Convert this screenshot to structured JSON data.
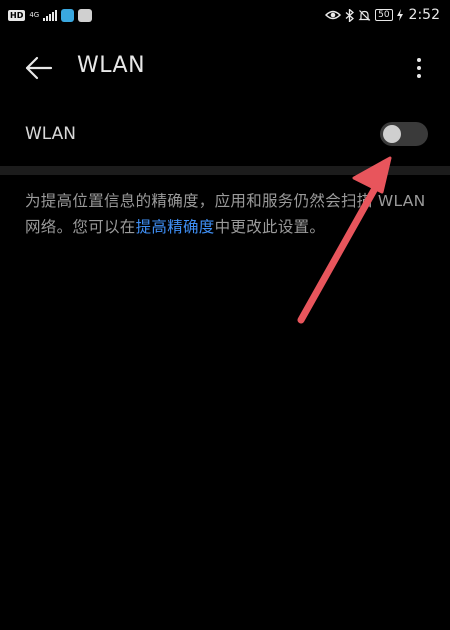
{
  "status_bar": {
    "hd": "HD",
    "net_type": "4G",
    "app_icon_label": "",
    "battery": "50",
    "time": "2:52"
  },
  "app_bar": {
    "title": "WLAN"
  },
  "wlan_row": {
    "label": "WLAN",
    "enabled": false
  },
  "description": {
    "before_link": "为提高位置信息的精确度，应用和服务仍然会扫描 WLAN 网络。您可以在",
    "link": "提高精确度",
    "after_link": "中更改此设置。"
  },
  "colors": {
    "background": "#000000",
    "text_primary": "#e8e8e8",
    "text_secondary": "#9a9a9a",
    "link": "#3f8ff5",
    "annotation_arrow": "#e8555c"
  }
}
